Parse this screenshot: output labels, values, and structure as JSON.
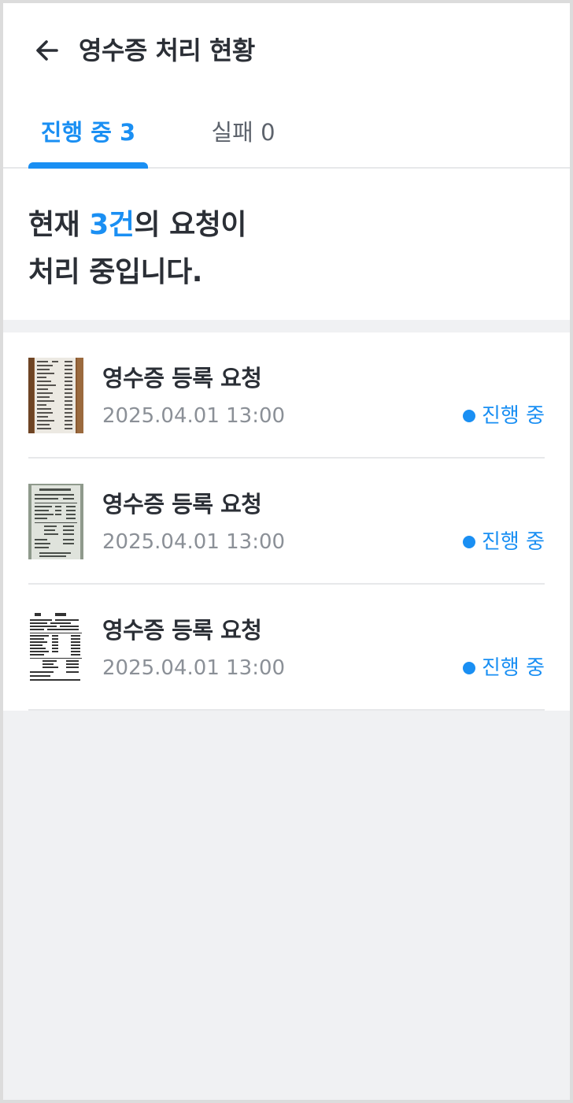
{
  "header": {
    "title": "영수증 처리 현황",
    "back_icon": "arrow-left-icon"
  },
  "tabs": [
    {
      "label": "진행 중 3",
      "active": true
    },
    {
      "label": "실패 0",
      "active": false
    }
  ],
  "summary": {
    "prefix": "현재 ",
    "count": "3건",
    "suffix_line1": "의 요청이",
    "line2": "처리 중입니다."
  },
  "requests": [
    {
      "title": "영수증 등록 요청",
      "date": "2025.04.01 13:00",
      "status": "진행 중",
      "thumb_style": "wood"
    },
    {
      "title": "영수증 등록 요청",
      "date": "2025.04.01 13:00",
      "status": "진행 중",
      "thumb_style": "green"
    },
    {
      "title": "영수증 등록 요청",
      "date": "2025.04.01 13:00",
      "status": "진행 중",
      "thumb_style": "white"
    }
  ],
  "colors": {
    "accent": "#1a8ff3",
    "text_primary": "#2b2f36",
    "text_secondary": "#8b9097",
    "background": "#f0f1f3"
  }
}
